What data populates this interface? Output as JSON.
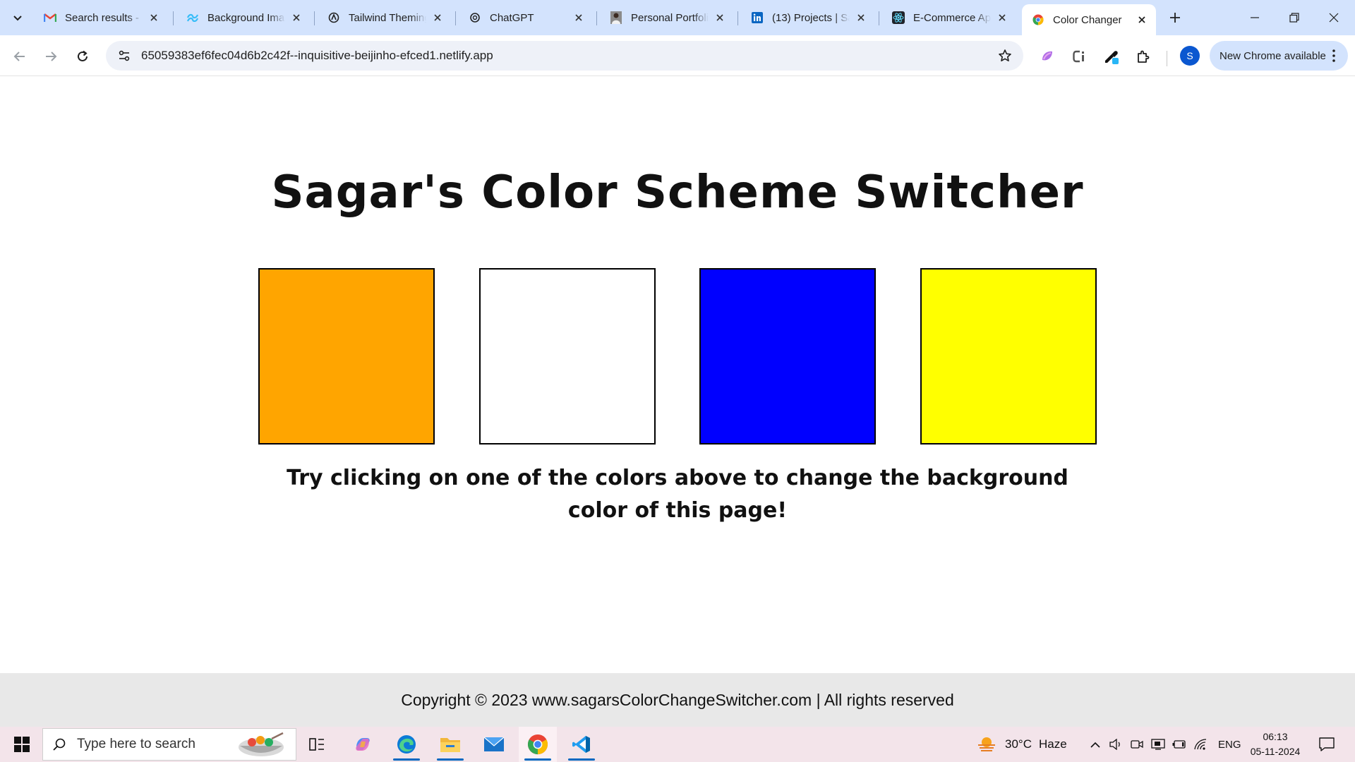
{
  "tabs": [
    {
      "title": "Search results - s",
      "icon": "gmail-icon"
    },
    {
      "title": "Background Ima",
      "icon": "tailwind-icon"
    },
    {
      "title": "Tailwind Theming",
      "icon": "theming-icon"
    },
    {
      "title": "ChatGPT",
      "icon": "chatgpt-icon"
    },
    {
      "title": "Personal Portfolio",
      "icon": "portrait-icon"
    },
    {
      "title": "(13) Projects | Sa",
      "icon": "linkedin-icon"
    },
    {
      "title": "E-Commerce Ap",
      "icon": "react-icon"
    },
    {
      "title": "Color Changer",
      "icon": "chrome-icon",
      "active": true
    }
  ],
  "address_bar": {
    "url": "65059383ef6fec04d6b2c42f--inquisitive-beijinho-efced1.netlify.app"
  },
  "profile": {
    "initial": "S"
  },
  "update_chip": {
    "label": "New Chrome available"
  },
  "page": {
    "title": "Sagar's Color Scheme Switcher",
    "swatches": [
      {
        "name": "orange",
        "color": "#FFA500"
      },
      {
        "name": "white",
        "color": "#FFFFFF"
      },
      {
        "name": "blue",
        "color": "#0000FF"
      },
      {
        "name": "yellow",
        "color": "#FFFF00"
      }
    ],
    "hint": "Try clicking on one of the colors above to change the background color of this page!",
    "footer": "Copyright © 2023 www.sagarsColorChangeSwitcher.com | All rights reserved"
  },
  "taskbar": {
    "search_placeholder": "Type here to search",
    "weather": {
      "temp": "30°C",
      "condition": "Haze"
    },
    "language": "ENG",
    "time": "06:13",
    "date": "05-11-2024"
  }
}
